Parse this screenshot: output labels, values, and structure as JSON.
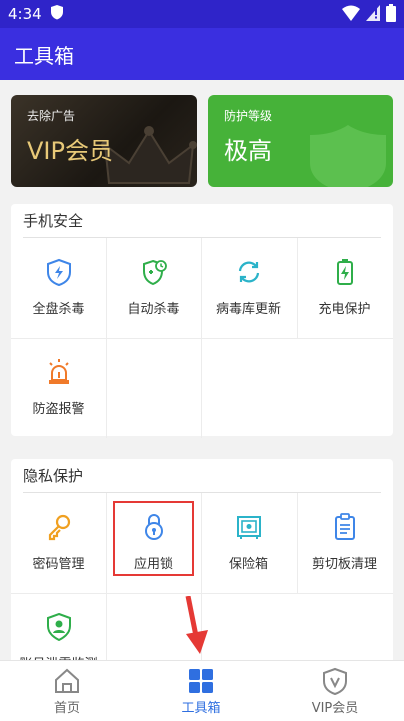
{
  "status": {
    "time": "4:34"
  },
  "appbar": {
    "title": "工具箱"
  },
  "promo": {
    "vip": {
      "caption": "去除广告",
      "title": "VIP会员"
    },
    "protection": {
      "caption": "防护等级",
      "title": "极高"
    }
  },
  "phone_security": {
    "title": "手机安全",
    "items": [
      {
        "label": "全盘杀毒",
        "icon": "shield-lightning-icon"
      },
      {
        "label": "自动杀毒",
        "icon": "shield-clock-icon"
      },
      {
        "label": "病毒库更新",
        "icon": "refresh-icon"
      },
      {
        "label": "充电保护",
        "icon": "battery-charge-icon"
      },
      {
        "label": "防盗报警",
        "icon": "alarm-icon"
      }
    ]
  },
  "privacy": {
    "title": "隐私保护",
    "items": [
      {
        "label": "密码管理",
        "icon": "key-icon"
      },
      {
        "label": "应用锁",
        "icon": "lock-icon"
      },
      {
        "label": "保险箱",
        "icon": "safe-icon"
      },
      {
        "label": "剪切板清理",
        "icon": "clipboard-icon"
      },
      {
        "label": "账号泄露监测",
        "icon": "account-shield-icon"
      }
    ]
  },
  "bottom_nav": [
    {
      "label": "首页",
      "icon": "home-icon"
    },
    {
      "label": "工具箱",
      "icon": "grid-icon"
    },
    {
      "label": "VIP会员",
      "icon": "vip-shield-icon"
    }
  ],
  "colors": {
    "appbar": "#3a2fe0",
    "statusbar": "#2f24c9",
    "protection_card": "#46b239",
    "vip_gold": "#e8c978",
    "nav_active": "#2f6fe0",
    "highlight": "#e53935"
  }
}
